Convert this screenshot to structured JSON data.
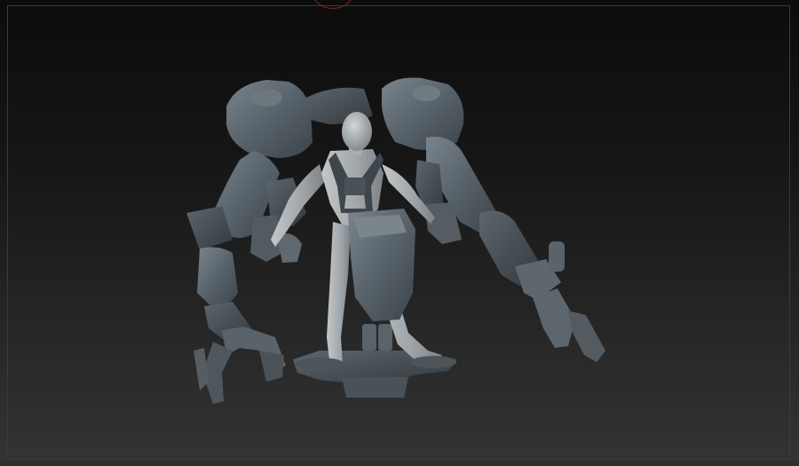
{
  "viewport": {
    "background_top": "#0c0c0c",
    "background_bottom": "#343434",
    "frame_color": "#3a3a3a",
    "orientation_ring_color": "#8a2020"
  },
  "model": {
    "material_color": "#5f6870",
    "skin_color": "#9aa0a4"
  }
}
